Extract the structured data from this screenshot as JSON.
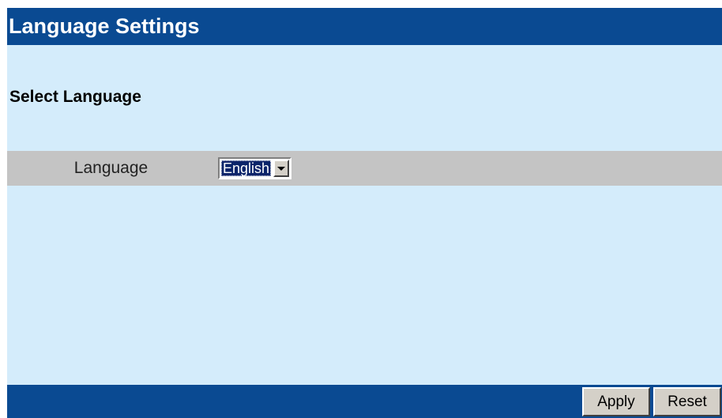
{
  "header": {
    "title": "Language Settings"
  },
  "section": {
    "heading": "Select Language"
  },
  "language_row": {
    "label": "Language",
    "selected_value": "English",
    "arrow_icon": "chevron-down-icon"
  },
  "footer": {
    "apply_label": "Apply",
    "reset_label": "Reset"
  },
  "colors": {
    "bar_blue": "#0a4a92",
    "background": "#d4ecfb",
    "row_gray": "#c4c4c4",
    "selection_highlight": "#0a246a"
  }
}
